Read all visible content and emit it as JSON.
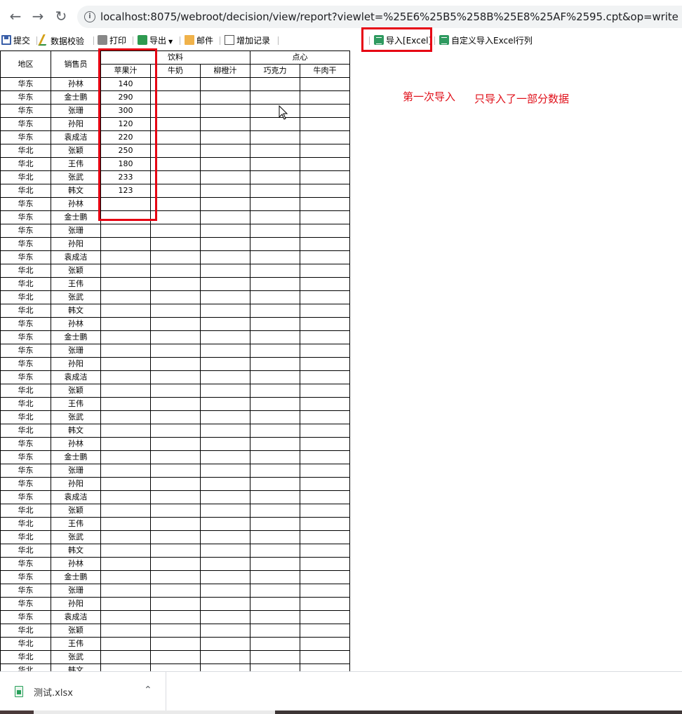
{
  "browser": {
    "back_icon": "arrow-left-icon",
    "forward_icon": "arrow-right-icon",
    "reload_icon": "reload-icon",
    "url": "localhost:8075/webroot/decision/view/report?viewlet=%25E6%25B5%258B%25E8%25AF%2595.cpt&op=write"
  },
  "toolbar": {
    "submit": "提交",
    "validate": "数据校验",
    "print": "打印",
    "export": "导出",
    "mail": "邮件",
    "add_record": "增加记录",
    "import_excel": "导入[Excel]",
    "custom_import": "自定义导入Excel行列"
  },
  "sheet": {
    "headers": {
      "region": "地区",
      "salesperson": "销售员",
      "group_drinks": "饮料",
      "group_snacks": "点心",
      "apple_juice": "苹果汁",
      "milk": "牛奶",
      "orange_juice": "柳橙汁",
      "chocolate": "巧克力",
      "jerky": "牛肉干"
    },
    "rows": [
      {
        "region": "华东",
        "name": "孙林",
        "apple": "140"
      },
      {
        "region": "华东",
        "name": "金士鹏",
        "apple": "290"
      },
      {
        "region": "华东",
        "name": "张珊",
        "apple": "300"
      },
      {
        "region": "华东",
        "name": "孙阳",
        "apple": "120"
      },
      {
        "region": "华东",
        "name": "袁成洁",
        "apple": "220"
      },
      {
        "region": "华北",
        "name": "张颖",
        "apple": "250"
      },
      {
        "region": "华北",
        "name": "王伟",
        "apple": "180"
      },
      {
        "region": "华北",
        "name": "张武",
        "apple": "233"
      },
      {
        "region": "华北",
        "name": "韩文",
        "apple": "123"
      },
      {
        "region": "华东",
        "name": "孙林",
        "apple": ""
      },
      {
        "region": "华东",
        "name": "金士鹏",
        "apple": ""
      },
      {
        "region": "华东",
        "name": "张珊",
        "apple": ""
      },
      {
        "region": "华东",
        "name": "孙阳",
        "apple": ""
      },
      {
        "region": "华东",
        "name": "袁成洁",
        "apple": ""
      },
      {
        "region": "华北",
        "name": "张颖",
        "apple": ""
      },
      {
        "region": "华北",
        "name": "王伟",
        "apple": ""
      },
      {
        "region": "华北",
        "name": "张武",
        "apple": ""
      },
      {
        "region": "华北",
        "name": "韩文",
        "apple": ""
      },
      {
        "region": "华东",
        "name": "孙林",
        "apple": ""
      },
      {
        "region": "华东",
        "name": "金士鹏",
        "apple": ""
      },
      {
        "region": "华东",
        "name": "张珊",
        "apple": ""
      },
      {
        "region": "华东",
        "name": "孙阳",
        "apple": ""
      },
      {
        "region": "华东",
        "name": "袁成洁",
        "apple": ""
      },
      {
        "region": "华北",
        "name": "张颖",
        "apple": ""
      },
      {
        "region": "华北",
        "name": "王伟",
        "apple": ""
      },
      {
        "region": "华北",
        "name": "张武",
        "apple": ""
      },
      {
        "region": "华北",
        "name": "韩文",
        "apple": ""
      },
      {
        "region": "华东",
        "name": "孙林",
        "apple": ""
      },
      {
        "region": "华东",
        "name": "金士鹏",
        "apple": ""
      },
      {
        "region": "华东",
        "name": "张珊",
        "apple": ""
      },
      {
        "region": "华东",
        "name": "孙阳",
        "apple": ""
      },
      {
        "region": "华东",
        "name": "袁成洁",
        "apple": ""
      },
      {
        "region": "华北",
        "name": "张颖",
        "apple": ""
      },
      {
        "region": "华北",
        "name": "王伟",
        "apple": ""
      },
      {
        "region": "华北",
        "name": "张武",
        "apple": ""
      },
      {
        "region": "华北",
        "name": "韩文",
        "apple": ""
      },
      {
        "region": "华东",
        "name": "孙林",
        "apple": ""
      },
      {
        "region": "华东",
        "name": "金士鹏",
        "apple": ""
      },
      {
        "region": "华东",
        "name": "张珊",
        "apple": ""
      },
      {
        "region": "华东",
        "name": "孙阳",
        "apple": ""
      },
      {
        "region": "华东",
        "name": "袁成洁",
        "apple": ""
      },
      {
        "region": "华北",
        "name": "张颖",
        "apple": ""
      },
      {
        "region": "华北",
        "name": "王伟",
        "apple": ""
      },
      {
        "region": "华北",
        "name": "张武",
        "apple": ""
      },
      {
        "region": "华北",
        "name": "韩文",
        "apple": ""
      }
    ]
  },
  "annotations": {
    "first_import": "第一次导入",
    "partial_note": "只导入了一部分数据"
  },
  "download": {
    "filename": "测试.xlsx",
    "file_icon": "excel-file-icon",
    "chevron_icon": "chevron-up-icon"
  },
  "colors": {
    "highlight": "#e60012",
    "annotation": "#e0101a"
  }
}
